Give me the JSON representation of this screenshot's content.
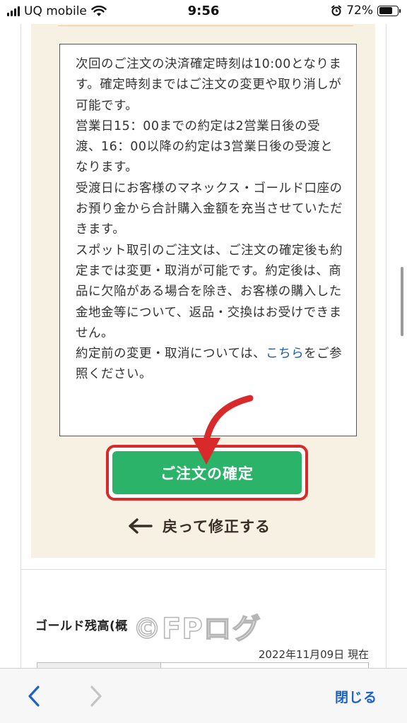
{
  "status_bar": {
    "carrier": "UQ mobile",
    "time": "9:56",
    "battery_percent": "72%",
    "battery_level": 0.72
  },
  "notice": {
    "paragraphs": [
      "次回のご注文の決済確定時刻は10:00となります。確定時刻まではご注文の変更や取り消しが可能です。",
      "営業日15：00までの約定は2営業日後の受渡、16：00以降の約定は3営業日後の受渡となります。",
      "受渡日にお客様のマネックス・ゴールド口座のお預り金から合計購入金額を充当させていただきます。",
      "スポット取引のご注文は、ご注文の確定後も約定までは変更・取消が可能です。約定後は、商品に欠陥がある場合を除き、お客様の購入した金地金等について、返品・交換はお受けできません。"
    ],
    "last_prefix": "約定前の変更・取消については、",
    "link_label": "こちら",
    "last_suffix": "をご参照ください。"
  },
  "actions": {
    "confirm_label": "ご注文の確定",
    "back_label": "戻って修正する"
  },
  "balance": {
    "title": "ゴールド残高(概",
    "as_of": "2022年11月09日 現在"
  },
  "watermark": "©FPログ",
  "toolbar": {
    "close_label": "閉じる"
  },
  "colors": {
    "panel_bg": "#f7f1e4",
    "confirm_green": "#2cb36a",
    "highlight_red": "#d82a2a",
    "link_blue": "#1f5aa8",
    "toolbar_blue": "#1d63c7"
  },
  "icons": {
    "signal": "signal-bars-icon",
    "wifi": "wifi-icon",
    "alarm": "alarm-icon",
    "battery": "battery-icon",
    "annotation": "red-curved-arrow-icon",
    "back": "arrow-left-icon",
    "nav_back": "chevron-left-icon",
    "nav_forward": "chevron-right-icon"
  }
}
